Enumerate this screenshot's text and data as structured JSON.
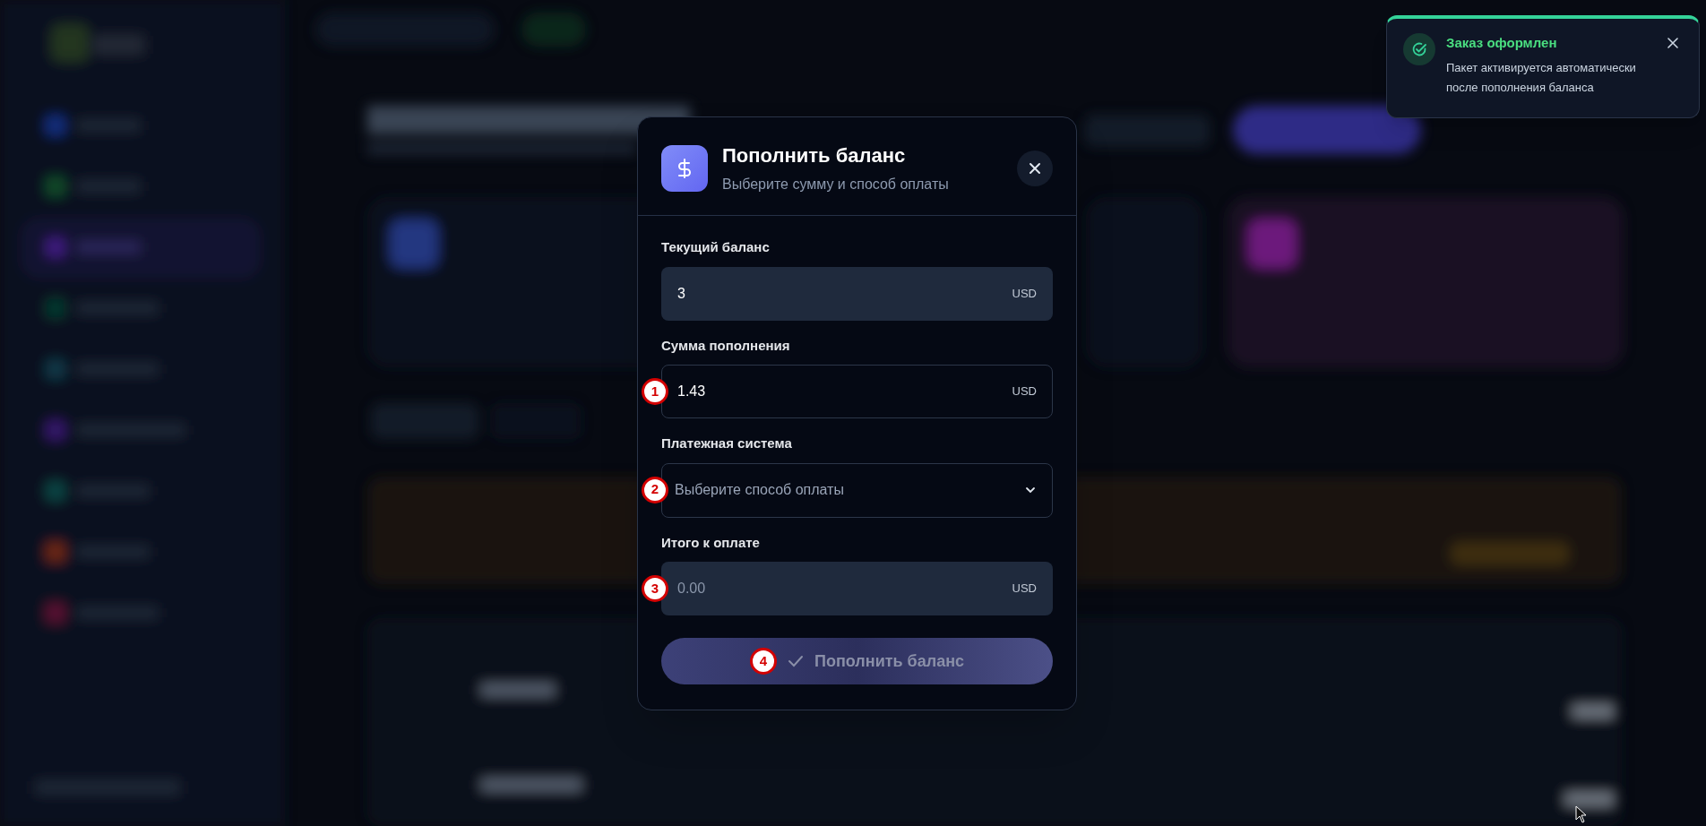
{
  "dialog": {
    "title": "Пополнить баланс",
    "subtitle": "Выберите сумму и способ оплаты",
    "fields": [
      {
        "kind": "readonly",
        "label": "Текущий баланс",
        "value": "3",
        "unit": "USD",
        "muted": false
      },
      {
        "kind": "input",
        "label": "Сумма пополнения",
        "value": "1.43",
        "unit": "USD",
        "marker": "1"
      },
      {
        "kind": "select",
        "label": "Платежная система",
        "placeholder": "Выберите способ оплаты",
        "marker": "2"
      },
      {
        "kind": "readonly",
        "label": "Итого к оплате",
        "value": "0.00",
        "unit": "USD",
        "muted": true,
        "marker": "3"
      }
    ],
    "submit": {
      "label": "Пополнить баланс",
      "disabled": true,
      "marker": "4"
    }
  },
  "toast": {
    "title": "Заказ оформлен",
    "message": "Пакет активируется автоматически после пополнения баланса"
  }
}
